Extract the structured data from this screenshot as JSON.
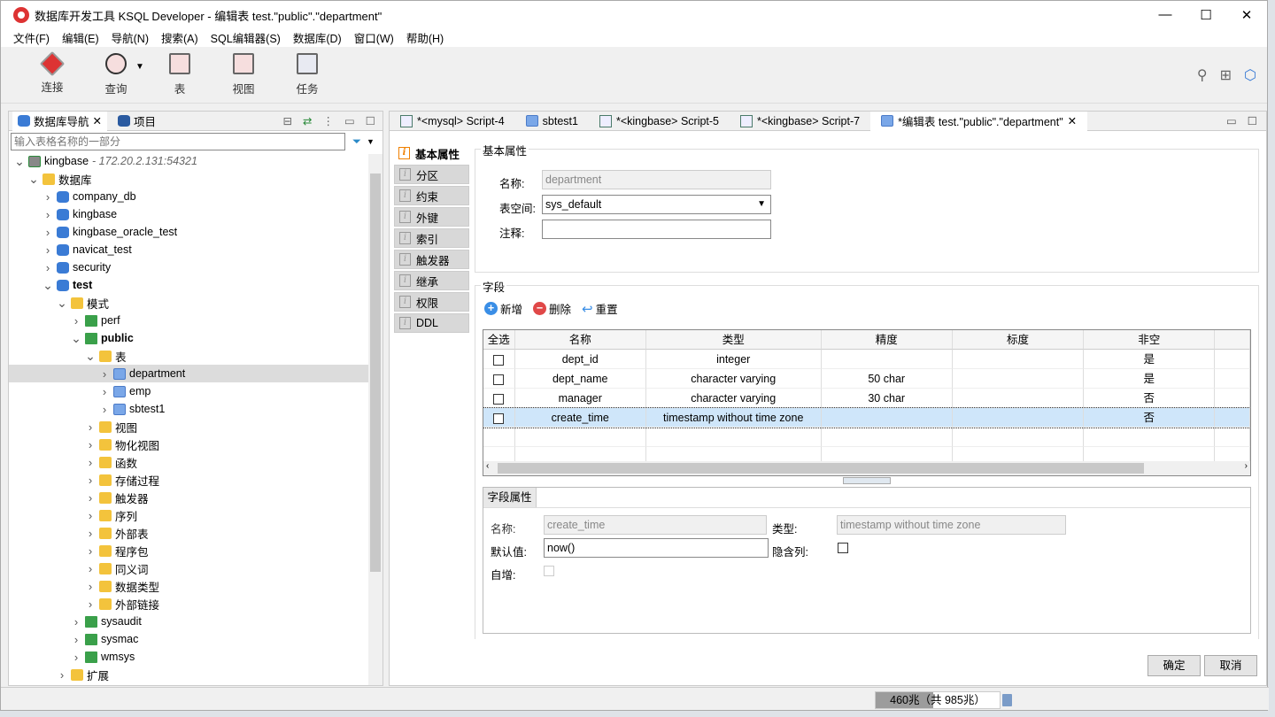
{
  "window": {
    "title": "数据库开发工具 KSQL Developer - 编辑表 test.\"public\".\"department\"",
    "minimize": "—",
    "maximize": "☐",
    "close": "✕"
  },
  "menu": [
    "文件(F)",
    "编辑(E)",
    "导航(N)",
    "搜索(A)",
    "SQL编辑器(S)",
    "数据库(D)",
    "窗口(W)",
    "帮助(H)"
  ],
  "toolbar": {
    "connect": "连接",
    "query": "查询",
    "table": "表",
    "view": "视图",
    "task": "任务"
  },
  "navigator": {
    "tab": "数据库导航",
    "project_tab": "项目",
    "filter_placeholder": "输入表格名称的一部分",
    "tree": [
      {
        "label": "kingbase",
        "extra": " - 172.20.2.131:54321",
        "depth": 0,
        "icon": "conn",
        "open": true
      },
      {
        "label": "数据库",
        "depth": 1,
        "icon": "folder",
        "open": true
      },
      {
        "label": "company_db",
        "depth": 2,
        "icon": "db"
      },
      {
        "label": "kingbase",
        "depth": 2,
        "icon": "db"
      },
      {
        "label": "kingbase_oracle_test",
        "depth": 2,
        "icon": "db"
      },
      {
        "label": "navicat_test",
        "depth": 2,
        "icon": "db"
      },
      {
        "label": "security",
        "depth": 2,
        "icon": "db"
      },
      {
        "label": "test",
        "depth": 2,
        "icon": "db",
        "open": true,
        "bold": true
      },
      {
        "label": "模式",
        "depth": 3,
        "icon": "folder",
        "open": true
      },
      {
        "label": "perf",
        "depth": 4,
        "icon": "schema"
      },
      {
        "label": "public",
        "depth": 4,
        "icon": "schema",
        "open": true,
        "bold": true
      },
      {
        "label": "表",
        "depth": 5,
        "icon": "folder",
        "open": true
      },
      {
        "label": "department",
        "depth": 6,
        "icon": "table",
        "selected": true
      },
      {
        "label": "emp",
        "depth": 6,
        "icon": "table"
      },
      {
        "label": "sbtest1",
        "depth": 6,
        "icon": "table"
      },
      {
        "label": "视图",
        "depth": 5,
        "icon": "folder"
      },
      {
        "label": "物化视图",
        "depth": 5,
        "icon": "folder"
      },
      {
        "label": "函数",
        "depth": 5,
        "icon": "folder"
      },
      {
        "label": "存储过程",
        "depth": 5,
        "icon": "folder"
      },
      {
        "label": "触发器",
        "depth": 5,
        "icon": "folder"
      },
      {
        "label": "序列",
        "depth": 5,
        "icon": "folder"
      },
      {
        "label": "外部表",
        "depth": 5,
        "icon": "folder"
      },
      {
        "label": "程序包",
        "depth": 5,
        "icon": "folder"
      },
      {
        "label": "同义词",
        "depth": 5,
        "icon": "folder"
      },
      {
        "label": "数据类型",
        "depth": 5,
        "icon": "folder"
      },
      {
        "label": "外部链接",
        "depth": 5,
        "icon": "folder"
      },
      {
        "label": "sysaudit",
        "depth": 4,
        "icon": "schema"
      },
      {
        "label": "sysmac",
        "depth": 4,
        "icon": "schema"
      },
      {
        "label": "wmsys",
        "depth": 4,
        "icon": "schema"
      },
      {
        "label": "扩展",
        "depth": 3,
        "icon": "folder"
      }
    ]
  },
  "editor_tabs": [
    {
      "label": "*<mysql> Script-4",
      "icon": "sql"
    },
    {
      "label": "sbtest1",
      "icon": "table"
    },
    {
      "label": "*<kingbase> Script-5",
      "icon": "sql"
    },
    {
      "label": "*<kingbase> Script-7",
      "icon": "sql"
    },
    {
      "label": "*编辑表 test.\"public\".\"department\"",
      "icon": "table",
      "active": true
    }
  ],
  "side_tabs": [
    "基本属性",
    "分区",
    "约束",
    "外键",
    "索引",
    "触发器",
    "继承",
    "权限",
    "DDL"
  ],
  "basic": {
    "group": "基本属性",
    "name_label": "名称:",
    "name_value": "department",
    "tablespace_label": "表空间:",
    "tablespace_value": "sys_default",
    "comment_label": "注释:",
    "comment_value": ""
  },
  "fields": {
    "group": "字段",
    "add": "新增",
    "delete": "删除",
    "reset": "重置",
    "columns": [
      "全选",
      "名称",
      "类型",
      "精度",
      "标度",
      "非空"
    ],
    "rows": [
      {
        "name": "dept_id",
        "type": "integer",
        "precision": "",
        "scale": "",
        "notnull": "是"
      },
      {
        "name": "dept_name",
        "type": "character varying",
        "precision": "50 char",
        "scale": "",
        "notnull": "是"
      },
      {
        "name": "manager",
        "type": "character varying",
        "precision": "30 char",
        "scale": "",
        "notnull": "否"
      },
      {
        "name": "create_time",
        "type": "timestamp without time zone",
        "precision": "",
        "scale": "",
        "notnull": "否",
        "selected": true
      }
    ]
  },
  "field_props": {
    "tab": "字段属性",
    "name_label": "名称:",
    "name_value": "create_time",
    "type_label": "类型:",
    "type_value": "timestamp without time zone",
    "default_label": "默认值:",
    "default_value": "now()",
    "hidden_label": "隐含列:",
    "autoinc_label": "自增:"
  },
  "buttons": {
    "ok": "确定",
    "cancel": "取消"
  },
  "status": {
    "memory_used_mb": 460,
    "memory_total_mb": 985,
    "memory_text": "460兆（共 985兆）"
  }
}
